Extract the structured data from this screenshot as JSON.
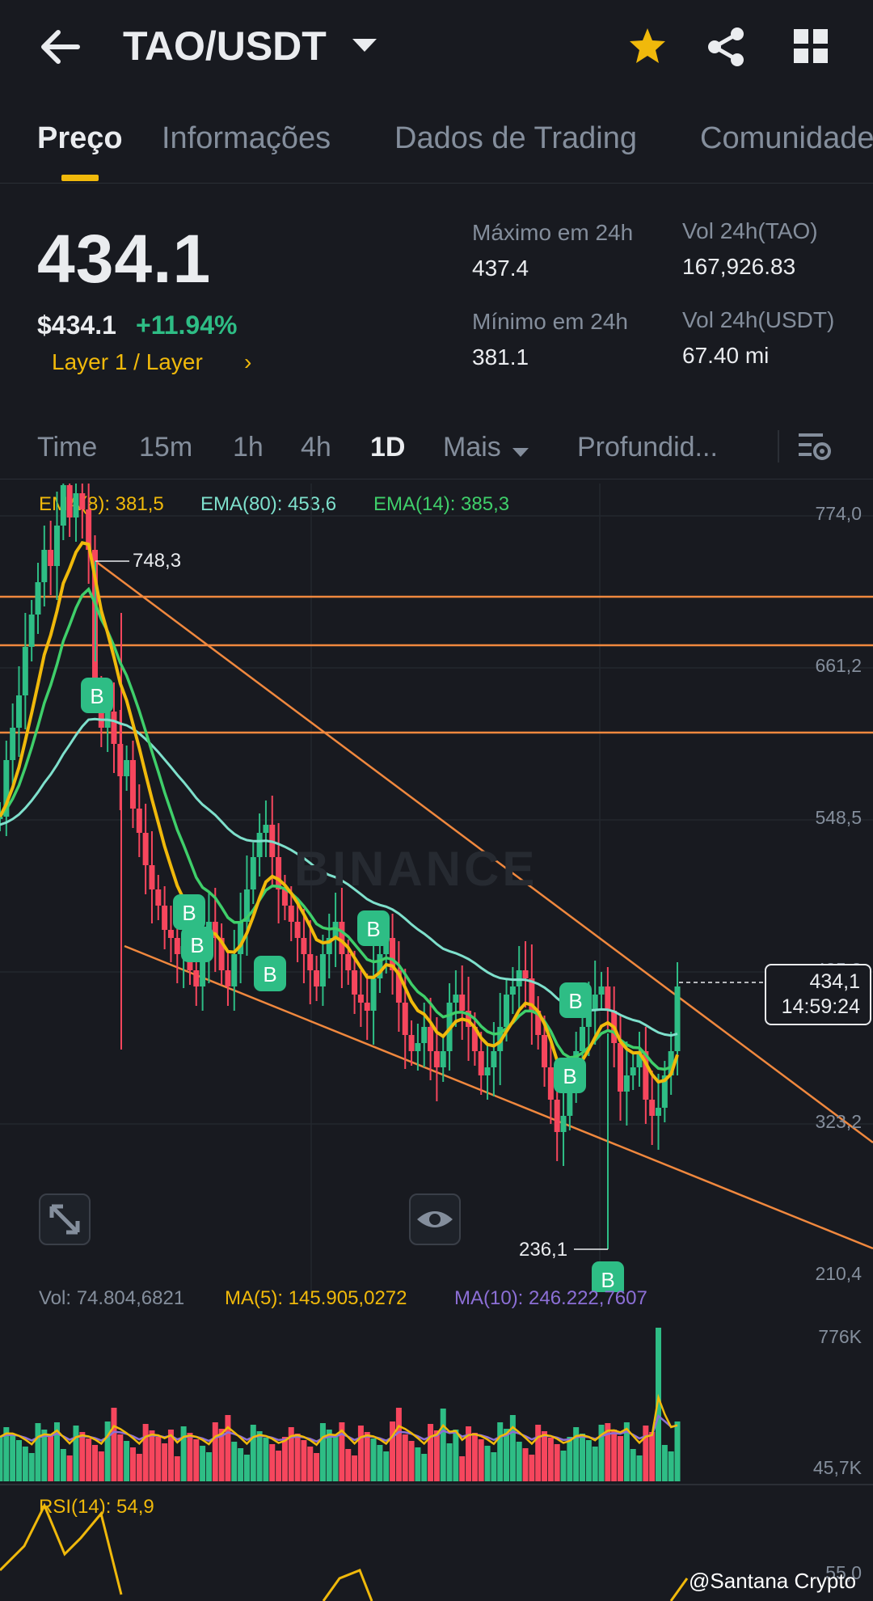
{
  "header": {
    "pair": "TAO/USDT",
    "icons": [
      "back-arrow-icon",
      "dropdown-caret-icon",
      "star-icon",
      "share-icon",
      "grid-icon"
    ]
  },
  "tabs": [
    "Preço",
    "Informações",
    "Dados de Trading",
    "Comunidade"
  ],
  "price": {
    "last": "434.1",
    "usd": "$434.1",
    "change": "+11.94%",
    "category": "Layer 1 / Layer",
    "high_label": "Máximo em 24h",
    "high_value": "437.4",
    "low_label": "Mínimo em 24h",
    "low_value": "381.1",
    "vol_base_label": "Vol 24h(TAO)",
    "vol_base_value": "167,926.83",
    "vol_quote_label": "Vol 24h(USDT)",
    "vol_quote_value": "67.40 mi"
  },
  "timeframes": [
    "Time",
    "15m",
    "1h",
    "4h",
    "1D",
    "Mais",
    "Profundid..."
  ],
  "active_timeframe": "1D",
  "indicators": {
    "ema8": "EMA(8): 381,5",
    "ema80": "EMA(80): 453,6",
    "ema14": "EMA(14): 385,3"
  },
  "axis": {
    "price_ticks": [
      "774,0",
      "661,2",
      "548,5",
      "435,8",
      "323,2",
      "210,4"
    ],
    "vol_ticks": [
      "776K",
      "45,7K"
    ],
    "rsi_tick": "55,0"
  },
  "annotations": {
    "high_marker": "748,3",
    "low_marker": "236,1",
    "current_price": "434,1",
    "countdown": "14:59:24",
    "buy_marker": "B"
  },
  "volume": {
    "vol": "Vol: 74.804,6821",
    "ma5": "MA(5): 145.905,0272",
    "ma10": "MA(10): 246.222,7607"
  },
  "rsi": {
    "label": "RSI(14): 54,9"
  },
  "watermark": "BINANCE",
  "credit": "@Santana Crypto",
  "colors": {
    "background": "#181a20",
    "up": "#2ebd85",
    "down": "#f6465d",
    "accent": "#f0b90b",
    "ema80": "#7ee0cc",
    "ema14": "#3fcf6a",
    "trendline": "#f0883e",
    "ma10": "#8c6fd6"
  }
}
